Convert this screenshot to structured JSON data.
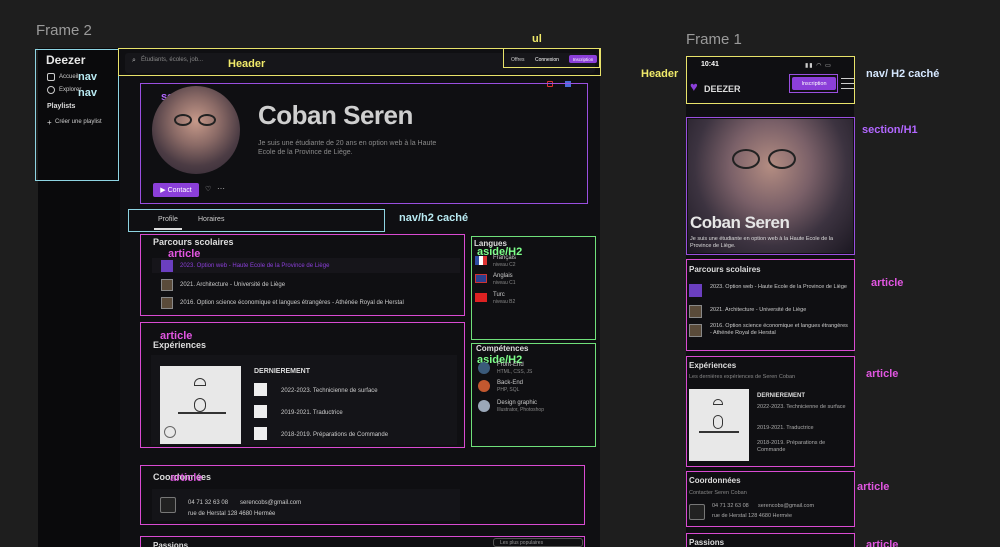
{
  "frames": {
    "left_title": "Frame 2",
    "right_title": "Frame 1"
  },
  "labels": {
    "ul": "ul",
    "header": "Header",
    "nav": "nav",
    "nav2": "nav",
    "section": "section/H1",
    "nav_h2_hidden": "nav/h2 caché",
    "article": "article",
    "aside_h2": "aside/H2",
    "header_right": "Header",
    "nav_h2_hidden_right": "nav/ H2 caché",
    "section_h1_right": "section/H1",
    "article_right": "article"
  },
  "sidebar": {
    "logo": "Deezer",
    "items": [
      "Accueil",
      "Explorer"
    ],
    "playlists_title": "Playlists",
    "create_playlist": "Créer une playlist"
  },
  "header": {
    "search_placeholder": "Étudiants, écoles, job...",
    "offers": "Offres",
    "login": "Connexion",
    "signup": "Inscription"
  },
  "profile": {
    "name": "Coban Seren",
    "bio": "Je suis une étudiante de 20 ans en option web à la Haute Ecole de la Province de Liège.",
    "contact": "Contact"
  },
  "tabs": [
    "Profile",
    "Horaires"
  ],
  "parcours": {
    "title": "Parcours scolaires",
    "items": [
      "2023. Option web - Haute Ecole de la Province de Liège",
      "2021. Architecture - Université de Liège",
      "2016. Option science économique et langues étrangères - Athénée Royal de Herstal"
    ]
  },
  "experiences": {
    "title": "Expériences",
    "recent": "DERNIEREMENT",
    "items": [
      "2022-2023. Technicienne de surface",
      "2019-2021. Traductrice",
      "2018-2019. Préparations de Commande"
    ]
  },
  "languages": {
    "title": "Langues",
    "items": [
      {
        "name": "Français",
        "level": "niveau C2"
      },
      {
        "name": "Anglais",
        "level": "niveau C1"
      },
      {
        "name": "Turc",
        "level": "niveau B2"
      }
    ]
  },
  "skills": {
    "title": "Compétences",
    "items": [
      {
        "name": "Front-End",
        "detail": "HTML, CSS, JS"
      },
      {
        "name": "Back-End",
        "detail": "PHP, SQL"
      },
      {
        "name": "Design graphic",
        "detail": "Illustrator, Photoshop"
      }
    ]
  },
  "contact_block": {
    "title": "Coordonnées",
    "phone": "04 71 32 63 08",
    "email": "serencobs@gmail.com",
    "address": "rue de Herstal 128 4680 Hermée",
    "subtitle_mobile": "Contacter Seren Coban"
  },
  "passions": {
    "title": "Passions",
    "filter": "Les plus populaires"
  },
  "mobile": {
    "time": "10:41",
    "logo": "DEEZER",
    "signup": "Inscription",
    "name": "Coban Seren",
    "bio": "Je suis une étudiante en option web à la Haute Ecole de la Province de Liège.",
    "parcours_items": [
      "2023. Option web - Haute Ecole de la Province de Liège",
      "2021. Architecture - Université de Liège",
      "2016. Option science économique et langues étrangères - Athénée Royal de Herstal"
    ],
    "exp_subtitle": "Les dernières expériences de Seren Coban",
    "exp_items": [
      "2022-2023. Technicienne de surface",
      "2019-2021. Traductrice",
      "2018-2019. Préparations de Commande"
    ],
    "coord_phone": "04 71 32 63 08",
    "coord_email": "serencobs@gmail.com",
    "coord_address": "rue de Herstal 128 4680 Hermée"
  },
  "colors": {
    "header_box": "#e8e26a",
    "section_box": "#9a4fe0",
    "nav_box": "#8ed4e2",
    "article_box": "#d94bd2",
    "aside_box": "#6fe07a",
    "accent": "#8b3fd9"
  }
}
